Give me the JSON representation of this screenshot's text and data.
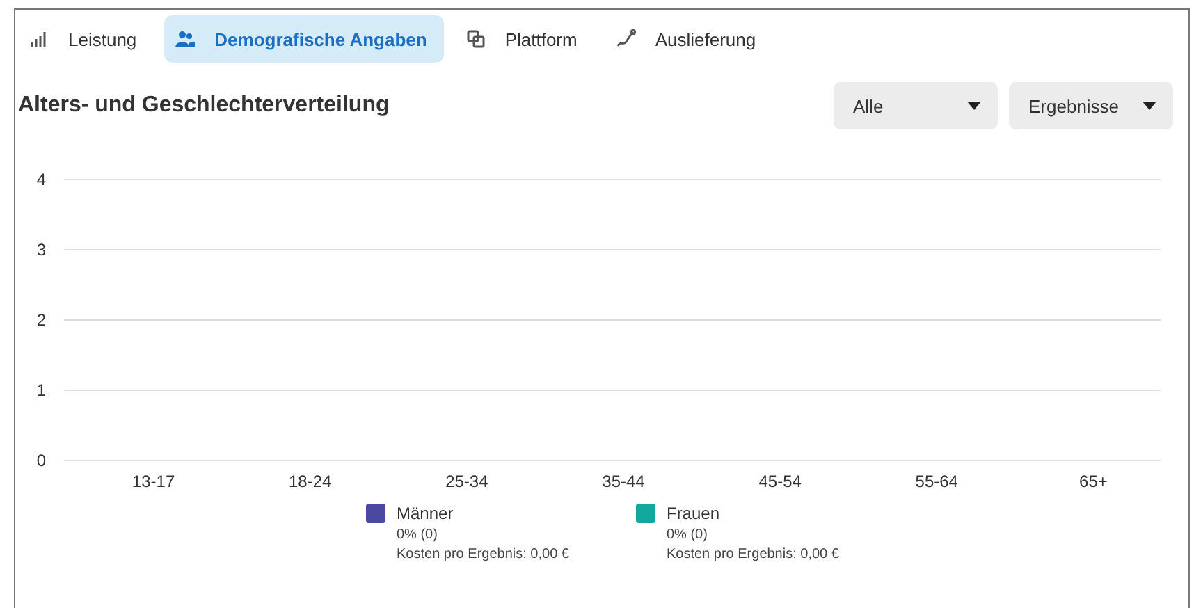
{
  "tabs": [
    {
      "label": "Leistung",
      "kind": "bars",
      "selected": false
    },
    {
      "label": "Demografische Angaben",
      "kind": "people",
      "selected": true
    },
    {
      "label": "Plattform",
      "kind": "squares",
      "selected": false
    },
    {
      "label": "Auslieferung",
      "kind": "path",
      "selected": false
    }
  ],
  "title": "Alters- und Geschlechterverteilung",
  "dropdowns": [
    "Alle",
    "Ergebnisse"
  ],
  "chart_data": {
    "type": "bar",
    "grid": true,
    "categories": [
      "13-17",
      "18-24",
      "25-34",
      "35-44",
      "45-54",
      "55-64",
      "65+"
    ],
    "yticks": [
      0,
      1,
      2,
      3,
      4
    ],
    "ylim": [
      0,
      4
    ],
    "series": [
      {
        "name": "Männer",
        "color": "#4a48a0",
        "values": [
          0,
          0,
          0,
          0,
          0,
          0,
          0
        ]
      },
      {
        "name": "Frauen",
        "color": "#13a89e",
        "values": [
          0,
          0,
          0,
          0,
          0,
          0,
          0
        ]
      }
    ]
  },
  "legend": [
    {
      "share": "0% (0)",
      "cost": "Kosten pro Ergebnis: 0,00 €"
    },
    {
      "share": "0% (0)",
      "cost": "Kosten pro Ergebnis: 0,00 €"
    }
  ]
}
